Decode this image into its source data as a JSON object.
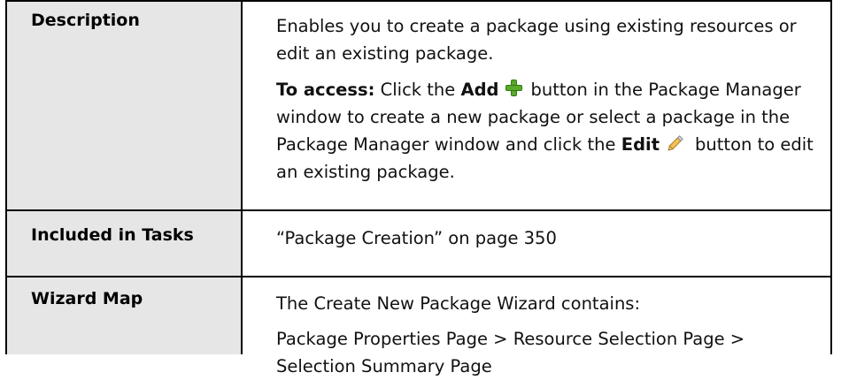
{
  "rows": {
    "description": {
      "label": "Description",
      "text1": "Enables you to create a package using existing resources or edit an existing package.",
      "access_label": "To access:",
      "access_part1": "Click the",
      "add_label": "Add",
      "access_part2": "button in the Package Manager window to create a new package or select a package in the Package Manager window and click the",
      "edit_label": "Edit",
      "access_part3": "button to edit an existing package."
    },
    "included": {
      "label": "Included in Tasks",
      "text": "“Package Creation” on page 350"
    },
    "wizard": {
      "label": "Wizard Map",
      "text1": "The Create New Package Wizard contains:",
      "text2": "Package Properties Page > Resource Selection Page > Selection Summary Page"
    }
  },
  "icons": {
    "add": "plus-icon",
    "edit": "pencil-icon"
  },
  "colors": {
    "header_bg": "#e6e6e6",
    "plus_green": "#5aa92c",
    "pencil_orange": "#e8a33a"
  }
}
